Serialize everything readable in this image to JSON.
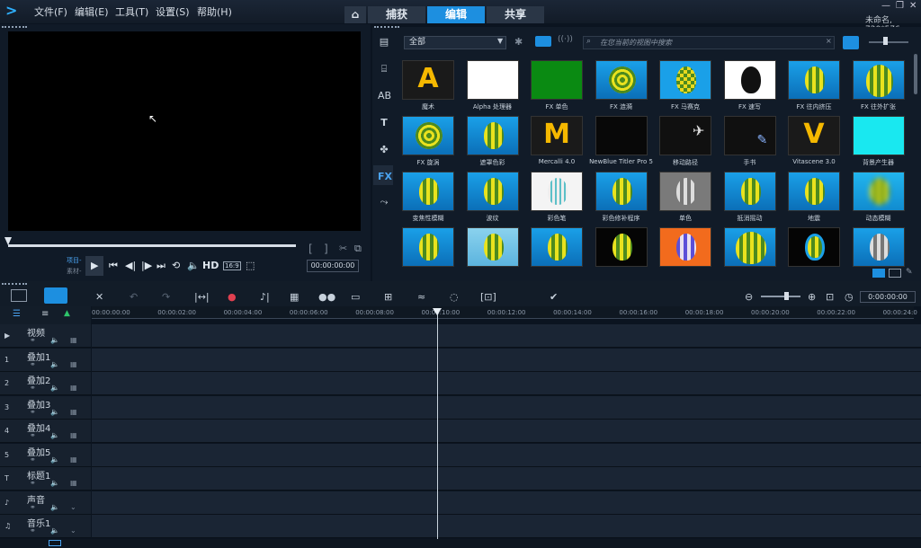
{
  "app": {
    "project_info": "未命名, 720*576"
  },
  "menu": [
    "文件(F)",
    "编辑(E)",
    "工具(T)",
    "设置(S)",
    "帮助(H)"
  ],
  "tabs": {
    "home": "⌂",
    "capture": "捕获",
    "edit": "编辑",
    "share": "共享"
  },
  "library": {
    "category": "全部",
    "search_placeholder": "在您当前的视图中搜索"
  },
  "effects": [
    {
      "label": "魔术",
      "style": "letterA"
    },
    {
      "label": "Alpha 处理器",
      "style": "white"
    },
    {
      "label": "FX 单色",
      "style": "green"
    },
    {
      "label": "FX 涟漪",
      "style": "swirl"
    },
    {
      "label": "FX 马赛克",
      "style": "mosaic"
    },
    {
      "label": "FX 速写",
      "style": "sketch"
    },
    {
      "label": "FX 往内挤压",
      "style": "balloon"
    },
    {
      "label": "FX 往外扩张",
      "style": "balloonbig"
    },
    {
      "label": "FX 旋涡",
      "style": "swirl2"
    },
    {
      "label": "遮罩色彩",
      "style": "balloon"
    },
    {
      "label": "Mercalli 4.0",
      "style": "letterM"
    },
    {
      "label": "NewBlue Titler Pro 5",
      "style": "black"
    },
    {
      "label": "移动路径",
      "style": "path"
    },
    {
      "label": "手书",
      "style": "hand"
    },
    {
      "label": "Vitascene 3.0",
      "style": "letterV"
    },
    {
      "label": "背景产生器",
      "style": "cyan"
    },
    {
      "label": "变焦性模糊",
      "style": "balloon"
    },
    {
      "label": "波纹",
      "style": "balloon"
    },
    {
      "label": "彩色笔",
      "style": "pencil"
    },
    {
      "label": "彩色修补程序",
      "style": "balloon"
    },
    {
      "label": "单色",
      "style": "gray"
    },
    {
      "label": "抵消摇动",
      "style": "balloon"
    },
    {
      "label": "地震",
      "style": "balloon"
    },
    {
      "label": "动态模糊",
      "style": "blur"
    },
    {
      "label": "",
      "style": "balloon"
    },
    {
      "label": "",
      "style": "balloonpale"
    },
    {
      "label": "",
      "style": "balloon"
    },
    {
      "label": "",
      "style": "split"
    },
    {
      "label": "",
      "style": "orange"
    },
    {
      "label": "",
      "style": "darkballoon"
    },
    {
      "label": "",
      "style": "framed"
    },
    {
      "label": "",
      "style": "grayballoon"
    }
  ],
  "player": {
    "project_label": "项目-",
    "clip_label": "素材-",
    "timecode": "00:00:00:00",
    "hd": "HD",
    "aspect": "16:9"
  },
  "timeline": {
    "timecode": "0:00:00:00",
    "ticks": [
      "00:00:00:00",
      "00:00:02:00",
      "00:00:04:00",
      "00:00:06:00",
      "00:00:08:00",
      "00:00:10:00",
      "00:00:12:00",
      "00:00:14:00",
      "00:00:16:00",
      "00:00:18:00",
      "00:00:20:00",
      "00:00:22:00",
      "00:00:24:0"
    ],
    "tracks": [
      {
        "name": "视频",
        "icon": "▶"
      },
      {
        "name": "叠加1",
        "icon": "1"
      },
      {
        "name": "叠加2",
        "icon": "2"
      },
      {
        "name": "叠加3",
        "icon": "3"
      },
      {
        "name": "叠加4",
        "icon": "4"
      },
      {
        "name": "叠加5",
        "icon": "5"
      },
      {
        "name": "标题1",
        "icon": "T"
      },
      {
        "name": "声音",
        "icon": "♪"
      },
      {
        "name": "音乐1",
        "icon": "♫"
      }
    ]
  },
  "colors": {
    "accent": "#1d8fe0",
    "bg": "#0b1420"
  }
}
